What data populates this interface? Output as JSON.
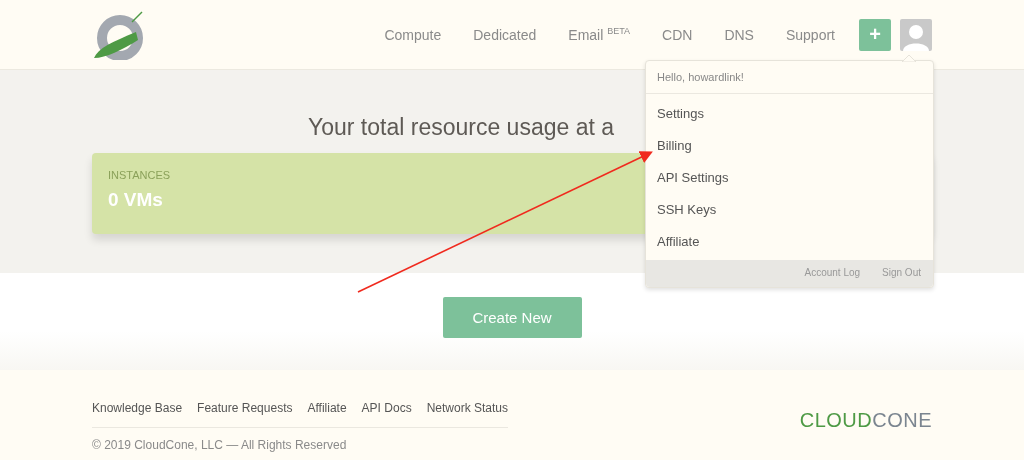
{
  "nav": {
    "items": [
      {
        "label": "Compute"
      },
      {
        "label": "Dedicated"
      },
      {
        "label": "Email $^{BETA}$"
      },
      {
        "label": "CDN"
      },
      {
        "label": "DNS"
      },
      {
        "label": "Support"
      }
    ],
    "add_button": "+"
  },
  "user_menu": {
    "greeting": "Hello, howardlink!",
    "items": [
      {
        "label": "Settings"
      },
      {
        "label": "Billing"
      },
      {
        "label": "API Settings"
      },
      {
        "label": "SSH Keys"
      },
      {
        "label": "Affiliate"
      }
    ],
    "footer_links": [
      "Account Log",
      "Sign Out"
    ]
  },
  "usage": {
    "heading": "Your total resource usage at a",
    "card": {
      "label": "INSTANCES",
      "value": "0 VMs"
    }
  },
  "create_button": "Create New",
  "footer": {
    "links": [
      "Knowledge Base",
      "Feature Requests",
      "Affiliate",
      "API Docs",
      "Network Status"
    ],
    "copyright": "© 2019 CloudCone, LLC — All Rights Reserved",
    "brand": [
      "CLOUD",
      "CONE"
    ]
  }
}
